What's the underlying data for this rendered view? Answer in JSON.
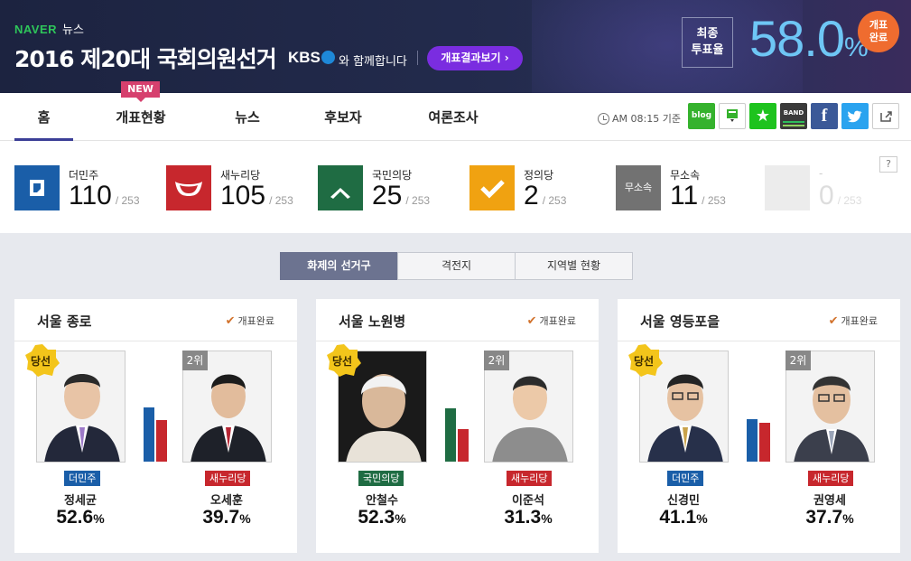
{
  "header": {
    "brand": "NAVER",
    "brand_section": "뉴스",
    "title": "2016 제20대 국회의원선거",
    "partner": "KBS",
    "partner_suffix": "와 함께합니다",
    "result_button": "개표결과보기 ›",
    "turnout_label_1": "최종",
    "turnout_label_2": "투표율",
    "turnout_value": "58.0",
    "turnout_unit": "%",
    "done_badge_1": "개표",
    "done_badge_2": "완료"
  },
  "nav": {
    "tabs": [
      "홈",
      "개표현황",
      "뉴스",
      "후보자",
      "여론조사"
    ],
    "active": "홈",
    "new_badge": "NEW",
    "updated": "AM 08:15 기준",
    "share": [
      "blog",
      "memo",
      "bookmark",
      "BAND",
      "f",
      "twitter",
      "share"
    ]
  },
  "parties": [
    {
      "name": "더민주",
      "seats": "110",
      "total": "/ 253",
      "color": "#1a5ea8",
      "icon": "minjoo-logo"
    },
    {
      "name": "새누리당",
      "seats": "105",
      "total": "/ 253",
      "color": "#c7272d",
      "icon": "saenuri-logo"
    },
    {
      "name": "국민의당",
      "seats": "25",
      "total": "/ 253",
      "color": "#1f6c43",
      "icon": "people-party-logo"
    },
    {
      "name": "정의당",
      "seats": "2",
      "total": "/ 253",
      "color": "#f0a211",
      "icon": "justice-party-logo"
    },
    {
      "name": "무소속",
      "seats": "11",
      "total": "/ 253",
      "color": "#727272",
      "icon": "independent-logo",
      "logo_text": "무소속"
    },
    {
      "name": "-",
      "seats": "0",
      "total": "/ 253",
      "color": "#ececec",
      "icon": "empty-logo"
    }
  ],
  "help": "?",
  "segments": [
    "화제의 선거구",
    "격전지",
    "지역별 현황"
  ],
  "segment_active": "화제의 선거구",
  "districts": [
    {
      "name": "서울 종로",
      "status": "개표완료",
      "winner": {
        "badge": "당선",
        "party": "더민주",
        "party_color": "#1a5ea8",
        "name": "정세균",
        "pct": "52.6",
        "unit": "%"
      },
      "second": {
        "rank": "2위",
        "party": "새누리당",
        "party_color": "#c7272d",
        "name": "오세훈",
        "pct": "39.7",
        "unit": "%"
      }
    },
    {
      "name": "서울 노원병",
      "status": "개표완료",
      "winner": {
        "badge": "당선",
        "party": "국민의당",
        "party_color": "#1f6c43",
        "name": "안철수",
        "pct": "52.3",
        "unit": "%"
      },
      "second": {
        "rank": "2위",
        "party": "새누리당",
        "party_color": "#c7272d",
        "name": "이준석",
        "pct": "31.3",
        "unit": "%"
      }
    },
    {
      "name": "서울 영등포을",
      "status": "개표완료",
      "winner": {
        "badge": "당선",
        "party": "더민주",
        "party_color": "#1a5ea8",
        "name": "신경민",
        "pct": "41.1",
        "unit": "%"
      },
      "second": {
        "rank": "2위",
        "party": "새누리당",
        "party_color": "#c7272d",
        "name": "권영세",
        "pct": "37.7",
        "unit": "%"
      }
    }
  ]
}
